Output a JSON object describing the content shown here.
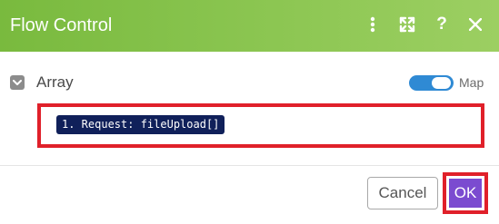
{
  "dialog": {
    "title": "Flow Control",
    "header_icons": [
      "more-vertical-icon",
      "expand-icon",
      "help-icon",
      "close-icon"
    ],
    "help_glyph": "?"
  },
  "field": {
    "label": "Array",
    "map_toggle_on": true,
    "map_label": "Map",
    "value_pill": "1. Request: fileUpload[]"
  },
  "footer": {
    "cancel_label": "Cancel",
    "ok_label": "OK"
  },
  "colors": {
    "header_green": "#8cc652",
    "ok_purple": "#7b4bd0",
    "highlight_red": "#e0202a",
    "toggle_blue": "#2f8ad4",
    "pill_navy": "#10205a"
  }
}
